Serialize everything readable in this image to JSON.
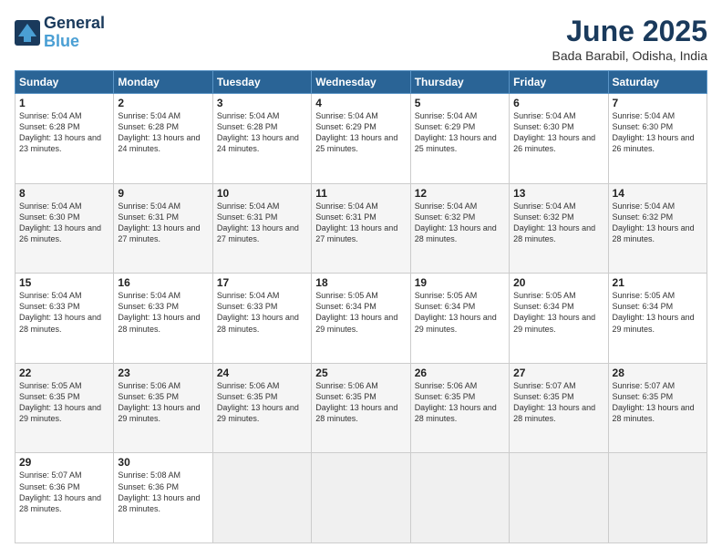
{
  "header": {
    "logo_line1": "General",
    "logo_line2": "Blue",
    "title": "June 2025",
    "location": "Bada Barabil, Odisha, India"
  },
  "days_of_week": [
    "Sunday",
    "Monday",
    "Tuesday",
    "Wednesday",
    "Thursday",
    "Friday",
    "Saturday"
  ],
  "weeks": [
    [
      {
        "day": "1",
        "rise": "Sunrise: 5:04 AM",
        "set": "Sunset: 6:28 PM",
        "daylight": "Daylight: 13 hours and 23 minutes."
      },
      {
        "day": "2",
        "rise": "Sunrise: 5:04 AM",
        "set": "Sunset: 6:28 PM",
        "daylight": "Daylight: 13 hours and 24 minutes."
      },
      {
        "day": "3",
        "rise": "Sunrise: 5:04 AM",
        "set": "Sunset: 6:28 PM",
        "daylight": "Daylight: 13 hours and 24 minutes."
      },
      {
        "day": "4",
        "rise": "Sunrise: 5:04 AM",
        "set": "Sunset: 6:29 PM",
        "daylight": "Daylight: 13 hours and 25 minutes."
      },
      {
        "day": "5",
        "rise": "Sunrise: 5:04 AM",
        "set": "Sunset: 6:29 PM",
        "daylight": "Daylight: 13 hours and 25 minutes."
      },
      {
        "day": "6",
        "rise": "Sunrise: 5:04 AM",
        "set": "Sunset: 6:30 PM",
        "daylight": "Daylight: 13 hours and 26 minutes."
      },
      {
        "day": "7",
        "rise": "Sunrise: 5:04 AM",
        "set": "Sunset: 6:30 PM",
        "daylight": "Daylight: 13 hours and 26 minutes."
      }
    ],
    [
      {
        "day": "8",
        "rise": "Sunrise: 5:04 AM",
        "set": "Sunset: 6:30 PM",
        "daylight": "Daylight: 13 hours and 26 minutes."
      },
      {
        "day": "9",
        "rise": "Sunrise: 5:04 AM",
        "set": "Sunset: 6:31 PM",
        "daylight": "Daylight: 13 hours and 27 minutes."
      },
      {
        "day": "10",
        "rise": "Sunrise: 5:04 AM",
        "set": "Sunset: 6:31 PM",
        "daylight": "Daylight: 13 hours and 27 minutes."
      },
      {
        "day": "11",
        "rise": "Sunrise: 5:04 AM",
        "set": "Sunset: 6:31 PM",
        "daylight": "Daylight: 13 hours and 27 minutes."
      },
      {
        "day": "12",
        "rise": "Sunrise: 5:04 AM",
        "set": "Sunset: 6:32 PM",
        "daylight": "Daylight: 13 hours and 28 minutes."
      },
      {
        "day": "13",
        "rise": "Sunrise: 5:04 AM",
        "set": "Sunset: 6:32 PM",
        "daylight": "Daylight: 13 hours and 28 minutes."
      },
      {
        "day": "14",
        "rise": "Sunrise: 5:04 AM",
        "set": "Sunset: 6:32 PM",
        "daylight": "Daylight: 13 hours and 28 minutes."
      }
    ],
    [
      {
        "day": "15",
        "rise": "Sunrise: 5:04 AM",
        "set": "Sunset: 6:33 PM",
        "daylight": "Daylight: 13 hours and 28 minutes."
      },
      {
        "day": "16",
        "rise": "Sunrise: 5:04 AM",
        "set": "Sunset: 6:33 PM",
        "daylight": "Daylight: 13 hours and 28 minutes."
      },
      {
        "day": "17",
        "rise": "Sunrise: 5:04 AM",
        "set": "Sunset: 6:33 PM",
        "daylight": "Daylight: 13 hours and 28 minutes."
      },
      {
        "day": "18",
        "rise": "Sunrise: 5:05 AM",
        "set": "Sunset: 6:34 PM",
        "daylight": "Daylight: 13 hours and 29 minutes."
      },
      {
        "day": "19",
        "rise": "Sunrise: 5:05 AM",
        "set": "Sunset: 6:34 PM",
        "daylight": "Daylight: 13 hours and 29 minutes."
      },
      {
        "day": "20",
        "rise": "Sunrise: 5:05 AM",
        "set": "Sunset: 6:34 PM",
        "daylight": "Daylight: 13 hours and 29 minutes."
      },
      {
        "day": "21",
        "rise": "Sunrise: 5:05 AM",
        "set": "Sunset: 6:34 PM",
        "daylight": "Daylight: 13 hours and 29 minutes."
      }
    ],
    [
      {
        "day": "22",
        "rise": "Sunrise: 5:05 AM",
        "set": "Sunset: 6:35 PM",
        "daylight": "Daylight: 13 hours and 29 minutes."
      },
      {
        "day": "23",
        "rise": "Sunrise: 5:06 AM",
        "set": "Sunset: 6:35 PM",
        "daylight": "Daylight: 13 hours and 29 minutes."
      },
      {
        "day": "24",
        "rise": "Sunrise: 5:06 AM",
        "set": "Sunset: 6:35 PM",
        "daylight": "Daylight: 13 hours and 29 minutes."
      },
      {
        "day": "25",
        "rise": "Sunrise: 5:06 AM",
        "set": "Sunset: 6:35 PM",
        "daylight": "Daylight: 13 hours and 28 minutes."
      },
      {
        "day": "26",
        "rise": "Sunrise: 5:06 AM",
        "set": "Sunset: 6:35 PM",
        "daylight": "Daylight: 13 hours and 28 minutes."
      },
      {
        "day": "27",
        "rise": "Sunrise: 5:07 AM",
        "set": "Sunset: 6:35 PM",
        "daylight": "Daylight: 13 hours and 28 minutes."
      },
      {
        "day": "28",
        "rise": "Sunrise: 5:07 AM",
        "set": "Sunset: 6:35 PM",
        "daylight": "Daylight: 13 hours and 28 minutes."
      }
    ],
    [
      {
        "day": "29",
        "rise": "Sunrise: 5:07 AM",
        "set": "Sunset: 6:36 PM",
        "daylight": "Daylight: 13 hours and 28 minutes."
      },
      {
        "day": "30",
        "rise": "Sunrise: 5:08 AM",
        "set": "Sunset: 6:36 PM",
        "daylight": "Daylight: 13 hours and 28 minutes."
      },
      null,
      null,
      null,
      null,
      null
    ]
  ]
}
